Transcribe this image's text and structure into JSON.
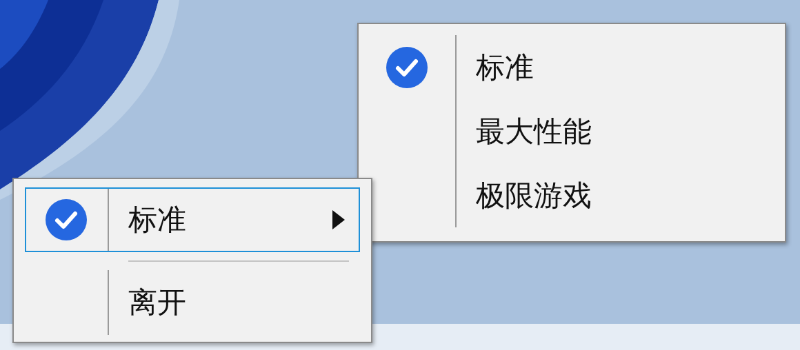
{
  "menus": [
    {
      "items": [
        {
          "kind": "item",
          "label": "标准",
          "checked": true,
          "highlighted": true,
          "submenu": true
        },
        {
          "kind": "separator"
        },
        {
          "kind": "item",
          "label": "离开",
          "checked": false,
          "highlighted": false,
          "submenu": false
        }
      ]
    },
    {
      "items": [
        {
          "kind": "item",
          "label": "标准",
          "checked": true,
          "highlighted": false,
          "submenu": false
        },
        {
          "kind": "item",
          "label": "最大性能",
          "checked": false,
          "highlighted": false,
          "submenu": false
        },
        {
          "kind": "item",
          "label": "极限游戏",
          "checked": false,
          "highlighted": false,
          "submenu": false
        }
      ]
    }
  ]
}
